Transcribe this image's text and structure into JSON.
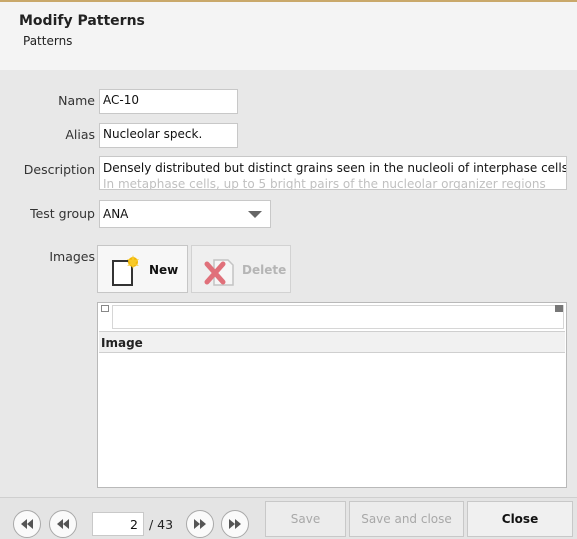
{
  "dialog": {
    "title": "Modify Patterns",
    "subtitle": "Patterns"
  },
  "form": {
    "name_label": "Name",
    "name_value": "AC-10",
    "alias_label": "Alias",
    "alias_value": "Nucleolar speck.",
    "description_label": "Description",
    "description_line1": "Densely distributed but distinct grains seen in the nucleoli of interphase cells.",
    "description_line2": "In metaphase cells, up to 5 bright pairs of the nucleolar organizer regions",
    "test_group_label": "Test group",
    "test_group_value": "ANA",
    "images_label": "Images"
  },
  "images_toolbar": {
    "new_label": "New",
    "delete_label": "Delete"
  },
  "images_grid": {
    "filter_value": "",
    "columns": [
      "Image"
    ],
    "rows": []
  },
  "footer": {
    "current_page": "2",
    "total_pages": "/ 43",
    "save_label": "Save",
    "save_close_label": "Save and close",
    "close_label": "Close"
  },
  "colors": {
    "accent_border": "#c9a86a",
    "new_icon_star": "#f2b705",
    "delete_icon_x": "#e0707a"
  },
  "icons": {
    "first_page": "double-chevron-left-icon",
    "prev_page": "chevron-left-icon",
    "next_page": "chevron-right-icon",
    "last_page": "double-chevron-right-icon",
    "new": "new-document-icon",
    "delete": "delete-document-icon"
  }
}
